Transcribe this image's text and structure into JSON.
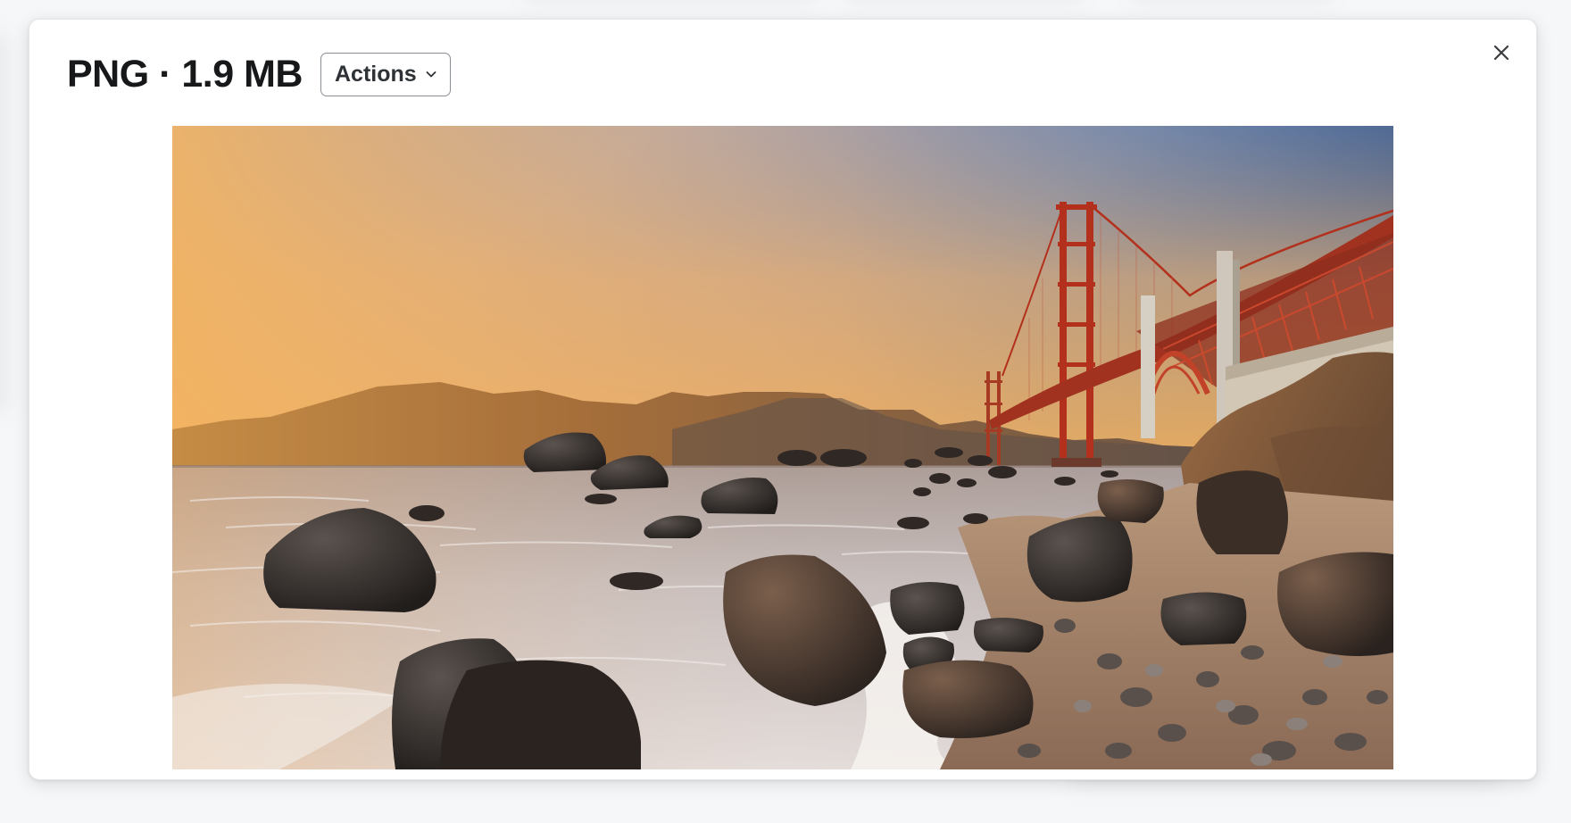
{
  "file": {
    "title": "PNG · 1.9 MB"
  },
  "toolbar": {
    "actions_label": "Actions",
    "actions_icon": "chevron-down-icon"
  },
  "close": {
    "icon": "close-icon"
  },
  "preview": {
    "alt": "Golden Gate Bridge at sunset over rocky beach"
  },
  "colors": {
    "title_text": "#16181a",
    "button_border": "#8a8f95",
    "modal_bg": "#ffffff",
    "bridge": "#b3301c"
  }
}
